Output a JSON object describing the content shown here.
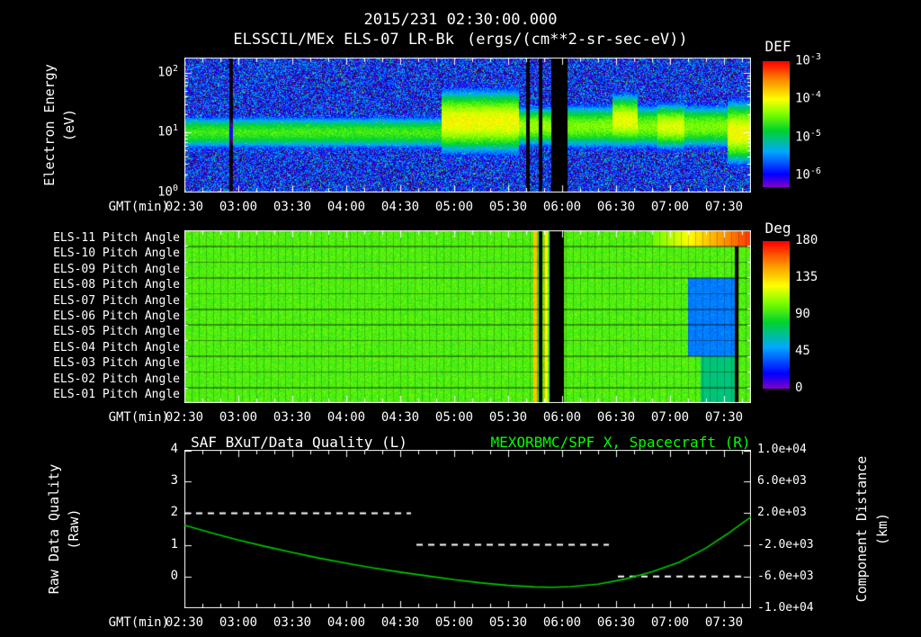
{
  "header": {
    "timestamp_title": "2015/231 02:30:00.000",
    "instrument_title": "ELSSCIL/MEx ELS-07 LR-Bk",
    "units_title": "(ergs/(cm**2-sr-sec-eV))"
  },
  "colors": {
    "background": "#000000",
    "text": "#ffffff",
    "accent_green": "#00ff00",
    "curve_green": "#00c800",
    "colormap_stops": [
      [
        0,
        "#7d00c8"
      ],
      [
        0.1,
        "#0000ff"
      ],
      [
        0.28,
        "#00aaff"
      ],
      [
        0.45,
        "#00d42d"
      ],
      [
        0.58,
        "#7dff00"
      ],
      [
        0.7,
        "#ffff00"
      ],
      [
        0.85,
        "#ff8c00"
      ],
      [
        1,
        "#ff0000"
      ]
    ]
  },
  "x_axis": {
    "label": "GMT(min)",
    "start_min": 150,
    "end_min": 465,
    "tick_interval_min": 30,
    "minor_tick_min": 10,
    "ticks": [
      "02:30",
      "03:00",
      "03:30",
      "04:00",
      "04:30",
      "05:00",
      "05:30",
      "06:00",
      "06:30",
      "07:00",
      "07:30"
    ]
  },
  "chart_data": [
    {
      "id": "electron_energy_spectrogram",
      "type": "heatmap",
      "ylabel": [
        "Electron Energy",
        "(eV)"
      ],
      "y_log_range": [
        0,
        2.25
      ],
      "y_ticks": [
        {
          "exp": "0",
          "log": 0
        },
        {
          "exp": "1",
          "log": 1
        },
        {
          "exp": "2",
          "log": 2
        }
      ],
      "colorbar": {
        "label": "DEF",
        "log_range": [
          -6.3,
          -3
        ],
        "ticks": [
          {
            "exp": "-3",
            "value": -3
          },
          {
            "exp": "-4",
            "value": -4
          },
          {
            "exp": "-5",
            "value": -5
          },
          {
            "exp": "-6",
            "value": -6
          }
        ]
      },
      "background_log": -5.9,
      "noise_amp": 0.7,
      "band_segments": [
        {
          "t": [
            150,
            293
          ],
          "center": 1.0,
          "width": 0.17,
          "peak": -4.6
        },
        {
          "t": [
            293,
            336
          ],
          "center": 1.18,
          "width": 0.3,
          "peak": -4.0
        },
        {
          "t": [
            336,
            363
          ],
          "center": 1.1,
          "width": 0.2,
          "peak": -4.3
        },
        {
          "t": [
            363,
            465
          ],
          "center": 1.1,
          "width": 0.22,
          "peak": -4.4
        }
      ],
      "bright_patches": [
        {
          "t": [
            388,
            402
          ],
          "center": 1.2,
          "width": 0.25,
          "peak": -4.05
        },
        {
          "t": [
            413,
            428
          ],
          "center": 1.1,
          "width": 0.22,
          "peak": -4.1
        },
        {
          "t": [
            452,
            465
          ],
          "center": 1.0,
          "width": 0.3,
          "peak": -4.0
        }
      ],
      "data_gaps_min": [
        [
          340,
          342
        ],
        [
          347,
          349
        ],
        [
          354,
          363
        ]
      ],
      "artifact_min": [
        175,
        177
      ]
    },
    {
      "id": "pitch_angle_panels",
      "type": "heatmap",
      "rows": [
        "ELS-11 Pitch Angle",
        "ELS-10 Pitch Angle",
        "ELS-09 Pitch Angle",
        "ELS-08 Pitch Angle",
        "ELS-07 Pitch Angle",
        "ELS-06 Pitch Angle",
        "ELS-05 Pitch Angle",
        "ELS-04 Pitch Angle",
        "ELS-03 Pitch Angle",
        "ELS-02 Pitch Angle",
        "ELS-01 Pitch Angle"
      ],
      "colorbar": {
        "label": "Deg",
        "range": [
          0,
          180
        ],
        "ticks": [
          180,
          135,
          90,
          45,
          0
        ]
      },
      "base_deg": 96,
      "noise_deg": 7,
      "features": [
        {
          "kind": "column",
          "t": [
            344,
            346
          ],
          "deg": 140
        },
        {
          "kind": "column",
          "t": [
            347,
            349
          ],
          "deg": null
        },
        {
          "kind": "column",
          "t": [
            350,
            352
          ],
          "deg": 128
        },
        {
          "kind": "column",
          "t": [
            353,
            361
          ],
          "deg": null
        },
        {
          "kind": "block",
          "rows": [
            3,
            7
          ],
          "t": [
            430,
            456
          ],
          "deg": 42
        },
        {
          "kind": "block",
          "rows": [
            8,
            10
          ],
          "t": [
            437,
            456
          ],
          "deg": 70
        },
        {
          "kind": "column",
          "t": [
            456,
            458
          ],
          "deg": null
        },
        {
          "kind": "ramp",
          "rows": [
            0,
            0
          ],
          "t": [
            410,
            465
          ],
          "deg_from": 100,
          "deg_to": 170
        }
      ]
    },
    {
      "id": "quality_and_distance",
      "type": "line",
      "title_left": "SAF_BXuT/Data Quality (L)",
      "title_right": "MEXORBMC/SPF X, Spacecraft (R)",
      "ylabel_left": [
        "Raw Data Quality",
        "(Raw)"
      ],
      "ylabel_right": [
        "Component Distance",
        "(km)"
      ],
      "y_left_range": [
        -1,
        4
      ],
      "y_left_ticks": [
        4,
        3,
        2,
        1,
        0
      ],
      "y_right_ticks": [
        "1.0e+04",
        "6.0e+03",
        "2.0e+03",
        "-2.0e+03",
        "-6.0e+03",
        "-1.0e+04"
      ],
      "quality_segments": [
        {
          "t": [
            150,
            276
          ],
          "value": 2
        },
        {
          "t": [
            279,
            386
          ],
          "value": 1
        },
        {
          "t": [
            391,
            462
          ],
          "value": 0
        }
      ],
      "distance_curve": {
        "t_min": [
          150,
          165,
          180,
          195,
          210,
          225,
          240,
          255,
          270,
          285,
          300,
          315,
          330,
          345,
          355,
          365,
          380,
          395,
          410,
          425,
          440,
          452,
          460,
          465
        ],
        "value_left": [
          1.62,
          1.38,
          1.15,
          0.95,
          0.76,
          0.58,
          0.42,
          0.27,
          0.14,
          0.02,
          -0.1,
          -0.2,
          -0.28,
          -0.33,
          -0.34,
          -0.32,
          -0.24,
          -0.08,
          0.15,
          0.45,
          0.9,
          1.35,
          1.68,
          1.88
        ]
      }
    }
  ]
}
